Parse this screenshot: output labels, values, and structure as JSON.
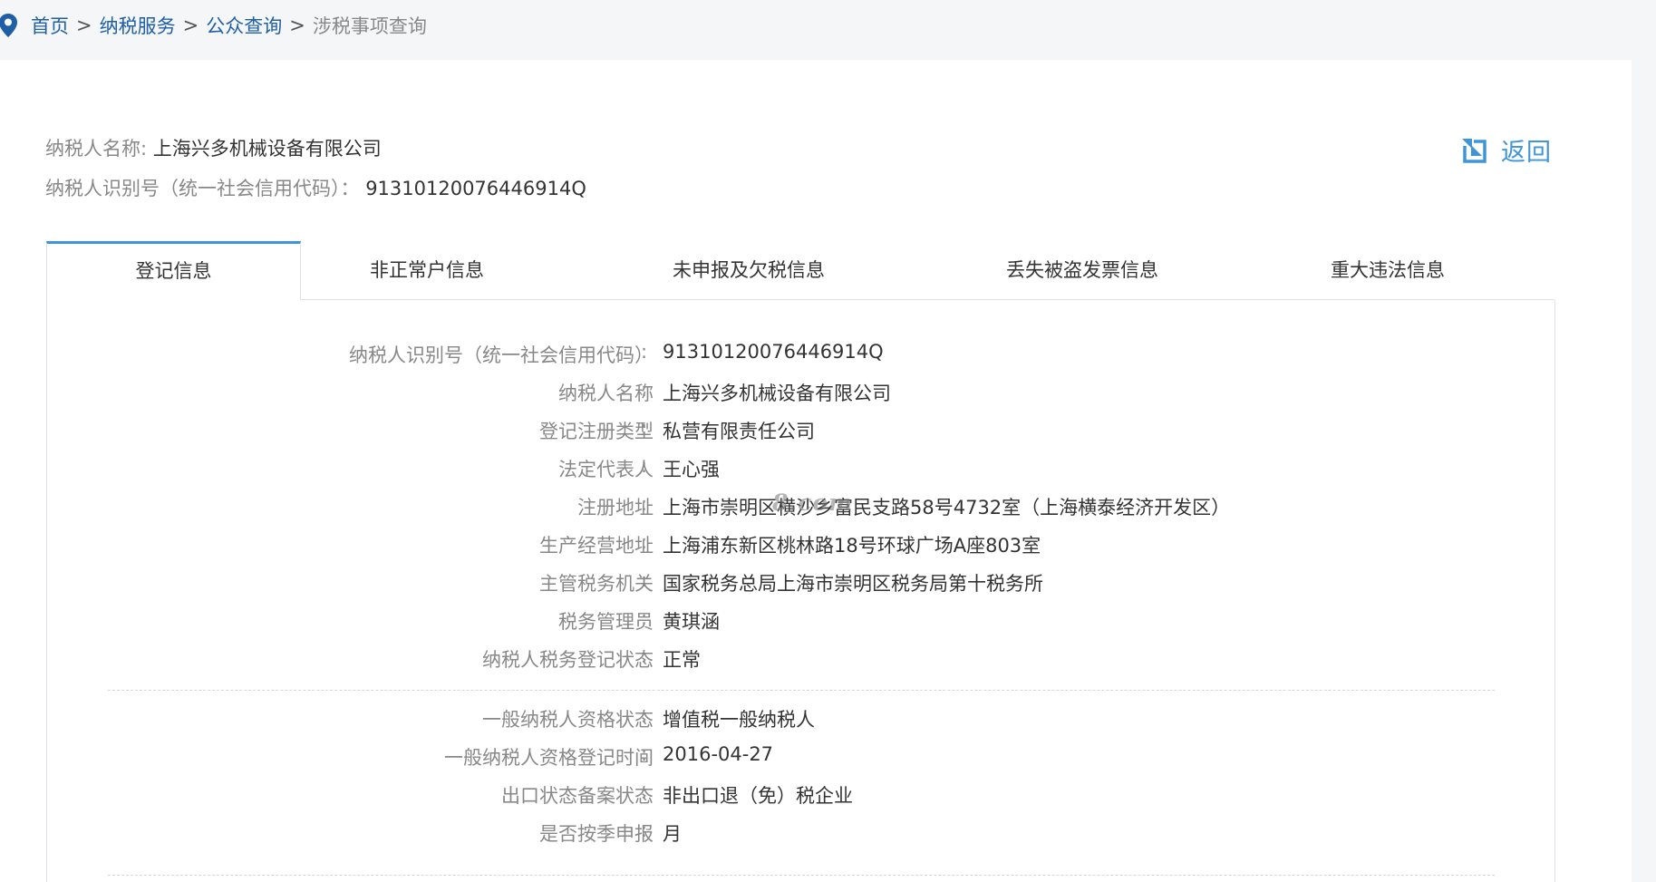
{
  "breadcrumb": {
    "items": [
      "首页",
      "纳税服务",
      "公众查询"
    ],
    "separator": ">",
    "current": "涉税事项查询"
  },
  "header": {
    "name_label": "纳税人名称:",
    "name_value": "上海兴多机械设备有限公司",
    "id_label": "纳税人识别号（统一社会信用代码）：",
    "id_value": "91310120076446914Q",
    "back_label": "返回"
  },
  "tabs": [
    {
      "label": "登记信息",
      "active": true
    },
    {
      "label": "非正常户信息",
      "active": false
    },
    {
      "label": "未申报及欠税信息",
      "active": false
    },
    {
      "label": "丢失被盗发票信息",
      "active": false
    },
    {
      "label": "重大违法信息",
      "active": false
    }
  ],
  "registration": {
    "group1": [
      {
        "label": "纳税人识别号（统一社会信用代码）",
        "value": "91310120076446914Q"
      },
      {
        "label": "纳税人名称",
        "value": "上海兴多机械设备有限公司"
      },
      {
        "label": "登记注册类型",
        "value": "私营有限责任公司"
      },
      {
        "label": "法定代表人",
        "value": "王心强"
      },
      {
        "label": "注册地址",
        "value": "上海市崇明区横沙乡富民支路58号4732室（上海横泰经济开发区）"
      },
      {
        "label": "生产经营地址",
        "value": "上海浦东新区桃林路18号环球广场A座803室"
      },
      {
        "label": "主管税务机关",
        "value": "国家税务总局上海市崇明区税务局第十税务所"
      },
      {
        "label": "税务管理员",
        "value": "黄琪涵"
      },
      {
        "label": "纳税人税务登记状态",
        "value": "正常"
      }
    ],
    "group2": [
      {
        "label": "一般纳税人资格状态",
        "value": "增值税一般纳税人"
      },
      {
        "label": "一般纳税人资格登记时间",
        "value": "2016-04-27"
      },
      {
        "label": "出口状态备案状态",
        "value": "非出口退（免）税企业"
      },
      {
        "label": "是否按季申报",
        "value": "月"
      }
    ],
    "colon": ":"
  },
  "watermark": "8.com",
  "colors": {
    "link": "#1f5fa6",
    "accent": "#3f95d6",
    "label": "#888888",
    "text": "#333333"
  }
}
